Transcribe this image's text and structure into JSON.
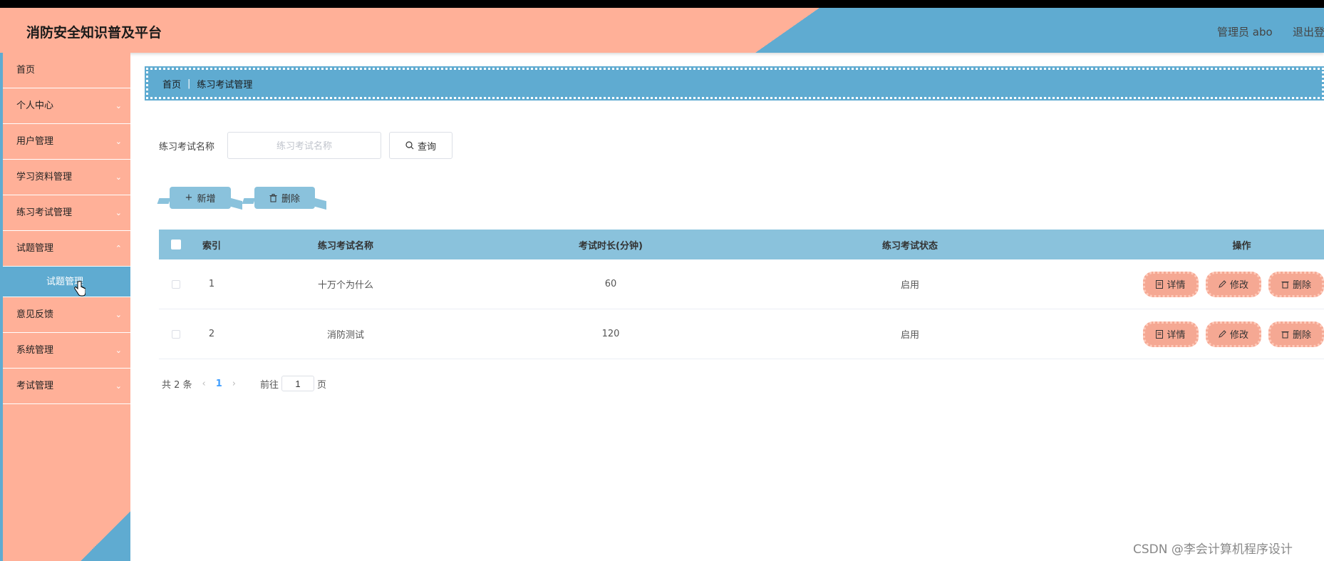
{
  "header": {
    "title": "消防安全知识普及平台",
    "user": "管理员 abo",
    "logout": "退出登录"
  },
  "sidebar": {
    "items": [
      {
        "label": "首页",
        "has_chevron": false
      },
      {
        "label": "个人中心",
        "has_chevron": true
      },
      {
        "label": "用户管理",
        "has_chevron": true
      },
      {
        "label": "学习资料管理",
        "has_chevron": true
      },
      {
        "label": "练习考试管理",
        "has_chevron": true
      },
      {
        "label": "试题管理",
        "has_chevron": true
      },
      {
        "label": "意见反馈",
        "has_chevron": true
      },
      {
        "label": "系统管理",
        "has_chevron": true
      },
      {
        "label": "考试管理",
        "has_chevron": true
      }
    ],
    "subitem": "试题管理"
  },
  "breadcrumb": {
    "home": "首页",
    "current": "练习考试管理"
  },
  "search": {
    "label": "练习考试名称",
    "placeholder": "练习考试名称",
    "value": "",
    "button": "查询"
  },
  "actions": {
    "add": "新增",
    "delete": "删除"
  },
  "table": {
    "headers": [
      "索引",
      "练习考试名称",
      "考试时长(分钟)",
      "练习考试状态",
      "操作"
    ],
    "rows": [
      {
        "index": "1",
        "name": "十万个为什么",
        "duration": "60",
        "status": "启用"
      },
      {
        "index": "2",
        "name": "消防测试",
        "duration": "120",
        "status": "启用"
      }
    ],
    "ops": {
      "detail": "详情",
      "edit": "修改",
      "delete": "删除"
    }
  },
  "pagination": {
    "total": "共 2 条",
    "current": "1",
    "goto": "前往",
    "page_value": "1",
    "page_suffix": "页"
  },
  "watermark": "CSDN @李会计算机程序设计",
  "colors": {
    "salmon": "#ffb098",
    "blue": "#5fabd1",
    "light_blue": "#8ac2dc",
    "op_button": "#f5a893"
  }
}
